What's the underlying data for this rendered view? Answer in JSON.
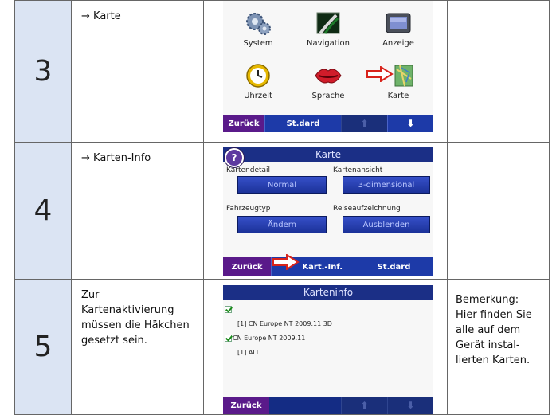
{
  "rows": [
    {
      "number": "3",
      "description": "→ Karte",
      "screen": {
        "tiles": [
          {
            "label": "System",
            "icon": "gears-icon"
          },
          {
            "label": "Navigation",
            "icon": "road-icon"
          },
          {
            "label": "Anzeige",
            "icon": "monitor-icon"
          },
          {
            "label": "Uhrzeit",
            "icon": "clock-icon"
          },
          {
            "label": "Sprache",
            "icon": "lips-icon"
          },
          {
            "label": "Karte",
            "icon": "map-icon"
          }
        ],
        "toolbar": {
          "back": "Zurück",
          "standard": "St.dard"
        }
      },
      "note": ""
    },
    {
      "number": "4",
      "description": "→ Karten-Info",
      "screen": {
        "title": "Karte",
        "fields": [
          {
            "label": "Kartendetail",
            "value": "Normal"
          },
          {
            "label": "Kartenansicht",
            "value": "3-dimensional"
          },
          {
            "label": "Fahrzeugtyp",
            "value": "Ändern"
          },
          {
            "label": "Reiseaufzeichnung",
            "value": "Ausblenden"
          }
        ],
        "toolbar": {
          "back": "Zurück",
          "info": "Kart.-Inf.",
          "standard": "St.dard"
        }
      },
      "note": ""
    },
    {
      "number": "5",
      "description": "Zur Kartenaktivierung müssen die Häkchen gesetzt sein.",
      "screen": {
        "title": "Karteninfo",
        "lines": [
          "[1] CN Europe NT 2009.11 3D",
          "CN Europe NT 2009.11",
          "[1] ALL"
        ],
        "toolbar": {
          "back": "Zurück"
        }
      },
      "note": "Bemerkung: Hier finden Sie alle auf dem Gerät instal-lierten Karten."
    }
  ],
  "colors": {
    "accent_blue": "#1b2f86",
    "back_purple": "#5a1a8a",
    "number_cell": "#dbe4f3",
    "pointer_red": "#d8231b"
  }
}
